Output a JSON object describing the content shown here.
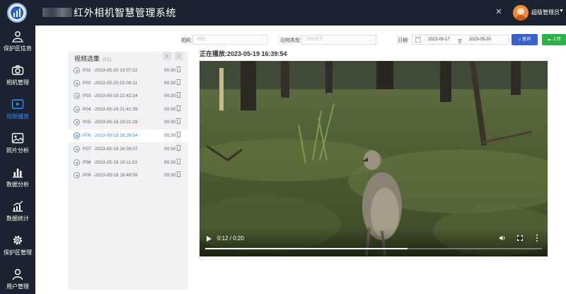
{
  "header": {
    "title": "红外相机智慧管理系统",
    "user_name": "超级管理员"
  },
  "sidebar": {
    "items": [
      {
        "label": "保护区信息",
        "icon": "area-person-icon"
      },
      {
        "label": "相机管理",
        "icon": "camera-icon"
      },
      {
        "label": "视频播放",
        "icon": "video-icon",
        "active": true
      },
      {
        "label": "照片分析",
        "icon": "image-icon"
      },
      {
        "label": "数据分析",
        "icon": "bar-chart-icon"
      },
      {
        "label": "数据统计",
        "icon": "trend-chart-icon"
      },
      {
        "label": "保护区管理",
        "icon": "gear-icon"
      },
      {
        "label": "用户管理",
        "icon": "user-icon"
      }
    ]
  },
  "filters": {
    "camera_label": "相机:",
    "camera_placeholder": "相机",
    "animal_label": "动物类型:",
    "animal_placeholder": "动物类型",
    "date_label": "日期:",
    "date_start": "2023-05-17",
    "date_sep": "至",
    "date_end": "2023-05-20",
    "query_label": "查询",
    "upload_label": "上传"
  },
  "playlist": {
    "title": "视频选集",
    "count": "(1/1)",
    "prev": "‹",
    "next": "›",
    "items": [
      {
        "code": "P01",
        "time": "-2023-05-20 13:07:22",
        "duration": "00:30"
      },
      {
        "code": "P02",
        "time": "-2023-05-20 01:06:11",
        "duration": "00:30"
      },
      {
        "code": "P03",
        "time": "-2023-05-19 22:42:24",
        "duration": "00:30"
      },
      {
        "code": "P04",
        "time": "-2023-05-19 21:41:39",
        "duration": "00:30"
      },
      {
        "code": "P05",
        "time": "-2023-05-19 19:21:28",
        "duration": "00:30"
      },
      {
        "code": "P06",
        "time": "-2023-05-19 16:39:54",
        "duration": "00:30",
        "active": true
      },
      {
        "code": "P07",
        "time": "-2023-05-19 16:26:07",
        "duration": "00:30"
      },
      {
        "code": "P08",
        "time": "-2023-05-18 19:11:03",
        "duration": "00:30"
      },
      {
        "code": "P09",
        "time": "-2023-05-18 18:48:59",
        "duration": "00:30"
      }
    ]
  },
  "player": {
    "now_playing": "正在播放:2023-05-19 16:39:54",
    "time": "0:12 / 0:20",
    "progress": 0.6
  },
  "colors": {
    "sidebar_bg": "#1b2330",
    "accent": "#3d8bf2",
    "query_btn": "#3a62c9",
    "upload_btn": "#2ab34a"
  }
}
